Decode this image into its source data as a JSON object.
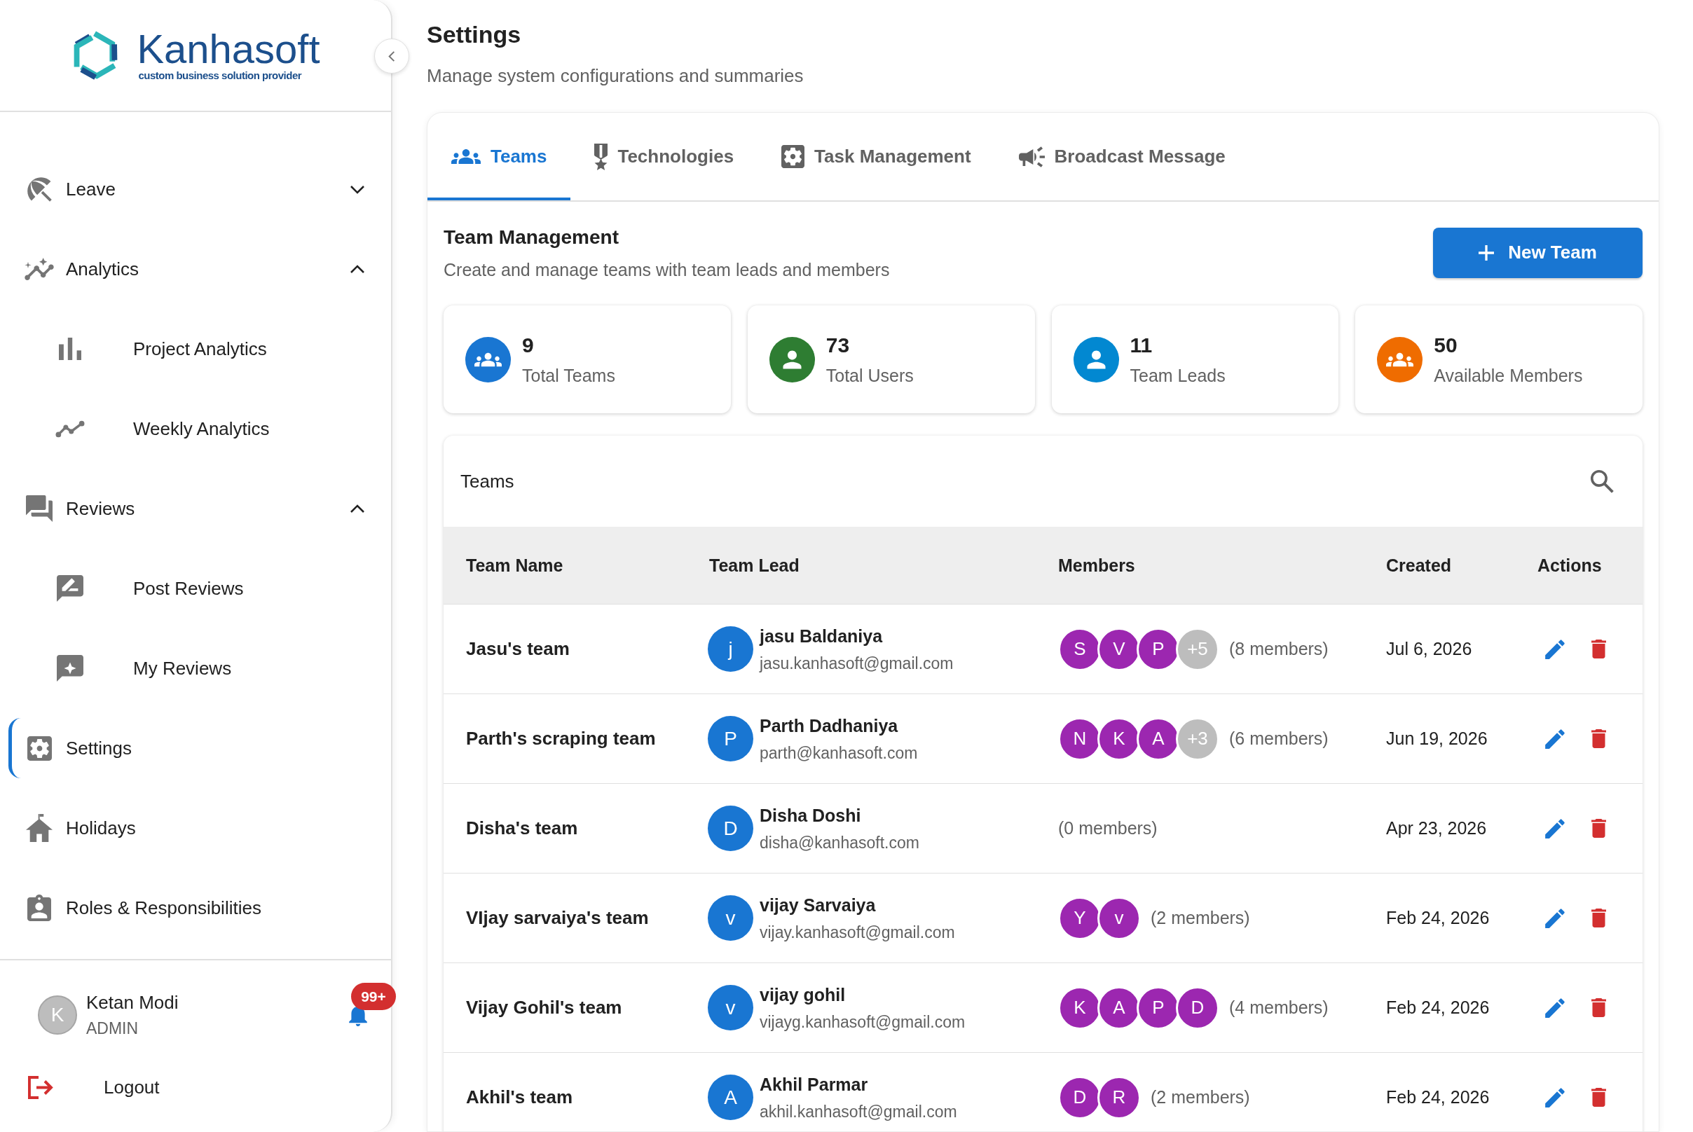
{
  "sidebar": {
    "brand": {
      "name": "Kanhasoft",
      "tagline": "custom business solution provider"
    },
    "items": [
      {
        "label": "Leave",
        "kind": "group",
        "expanded": false,
        "selected": false
      },
      {
        "label": "Analytics",
        "kind": "group",
        "expanded": true,
        "selected": false,
        "children": [
          {
            "label": "Project Analytics",
            "selected": false
          },
          {
            "label": "Weekly Analytics",
            "selected": false
          }
        ]
      },
      {
        "label": "Reviews",
        "kind": "group",
        "expanded": true,
        "selected": false,
        "children": [
          {
            "label": "Post Reviews",
            "selected": false
          },
          {
            "label": "My Reviews",
            "selected": false
          }
        ]
      },
      {
        "label": "Settings",
        "kind": "link",
        "selected": true
      },
      {
        "label": "Holidays",
        "kind": "link",
        "selected": false
      },
      {
        "label": "Roles & Responsibilities",
        "kind": "link",
        "selected": false
      }
    ],
    "user": {
      "initial": "K",
      "name": "Ketan Modi",
      "role": "ADMIN",
      "notifications": "99+"
    },
    "logout": "Logout"
  },
  "header": {
    "title": "Settings",
    "subtitle": "Manage system configurations and summaries"
  },
  "tabs": [
    {
      "label": "Teams",
      "selected": true
    },
    {
      "label": "Technologies",
      "selected": false
    },
    {
      "label": "Task Management",
      "selected": false
    },
    {
      "label": "Broadcast Message",
      "selected": false
    }
  ],
  "team_management": {
    "title": "Team Management",
    "subtitle": "Create and manage teams with team leads and members",
    "new_button": "New Team",
    "stats": [
      {
        "value": "9",
        "label": "Total Teams",
        "color": "#1976d2"
      },
      {
        "value": "73",
        "label": "Total Users",
        "color": "#2e7d32"
      },
      {
        "value": "11",
        "label": "Team Leads",
        "color": "#0288d1"
      },
      {
        "value": "50",
        "label": "Available Members",
        "color": "#ef6c00"
      }
    ]
  },
  "teams_table": {
    "title": "Teams",
    "columns": [
      "Team Name",
      "Team Lead",
      "Members",
      "Created",
      "Actions"
    ],
    "rows": [
      {
        "team": "Jasu's team",
        "lead": {
          "initial": "j",
          "name": "jasu Baldaniya",
          "email": "jasu.kanhasoft@gmail.com"
        },
        "members": [
          "S",
          "V",
          "P"
        ],
        "extra": "+5",
        "member_count": "(8 members)",
        "created": "Jul 6, 2026"
      },
      {
        "team": "Parth's scraping team",
        "lead": {
          "initial": "P",
          "name": "Parth Dadhaniya",
          "email": "parth@kanhasoft.com"
        },
        "members": [
          "N",
          "K",
          "A"
        ],
        "extra": "+3",
        "member_count": "(6 members)",
        "created": "Jun 19, 2026"
      },
      {
        "team": "Disha's team",
        "lead": {
          "initial": "D",
          "name": "Disha Doshi",
          "email": "disha@kanhasoft.com"
        },
        "member_count": "(0 members)",
        "created": "Apr 23, 2026"
      },
      {
        "team": "VIjay sarvaiya's team",
        "lead": {
          "initial": "v",
          "name": "vijay Sarvaiya",
          "email": "vijay.kanhasoft@gmail.com"
        },
        "members": [
          "Y",
          "v"
        ],
        "member_count": "(2 members)",
        "created": "Feb 24, 2026"
      },
      {
        "team": "Vijay Gohil's team",
        "lead": {
          "initial": "v",
          "name": "vijay gohil",
          "email": "vijayg.kanhasoft@gmail.com"
        },
        "members": [
          "K",
          "A",
          "P",
          "D"
        ],
        "member_count": "(4 members)",
        "created": "Feb 24, 2026"
      },
      {
        "team": "Akhil's team",
        "lead": {
          "initial": "A",
          "name": "Akhil Parmar",
          "email": "akhil.kanhasoft@gmail.com"
        },
        "members": [
          "D",
          "R"
        ],
        "member_count": "(2 members)",
        "created": "Feb 24, 2026"
      }
    ]
  }
}
